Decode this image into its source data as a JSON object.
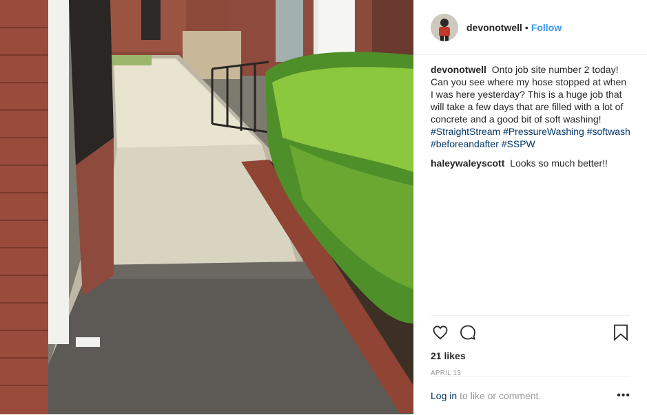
{
  "photo": {
    "alt_name": "post-photo"
  },
  "header": {
    "username": "devonotwell",
    "separator": "•",
    "follow_label": "Follow"
  },
  "caption": {
    "username": "devonotwell",
    "text": "Onto job site number 2 today! Can you see where my hose stopped at when I was here yesterday? This is a huge job that will take a few days that are filled with a lot of concrete and a good bit of soft washing!",
    "hashtags": [
      "#StraightStream",
      "#PressureWashing",
      "#softwash",
      "#beforeandafter",
      "#SSPW"
    ]
  },
  "comments": [
    {
      "username": "haleywaleyscott",
      "text": "Looks so much better!!"
    }
  ],
  "actions": {
    "like_icon": "heart-icon",
    "comment_icon": "comment-icon",
    "save_icon": "bookmark-icon"
  },
  "likes": "21 likes",
  "date": "APRIL 13",
  "footer": {
    "login_label": "Log in",
    "rest_text": "to like or comment.",
    "more_icon": "ellipsis-icon",
    "more_label": "•••"
  },
  "colors": {
    "link": "#3897f0",
    "hashtag": "#003569",
    "muted": "#999999"
  }
}
